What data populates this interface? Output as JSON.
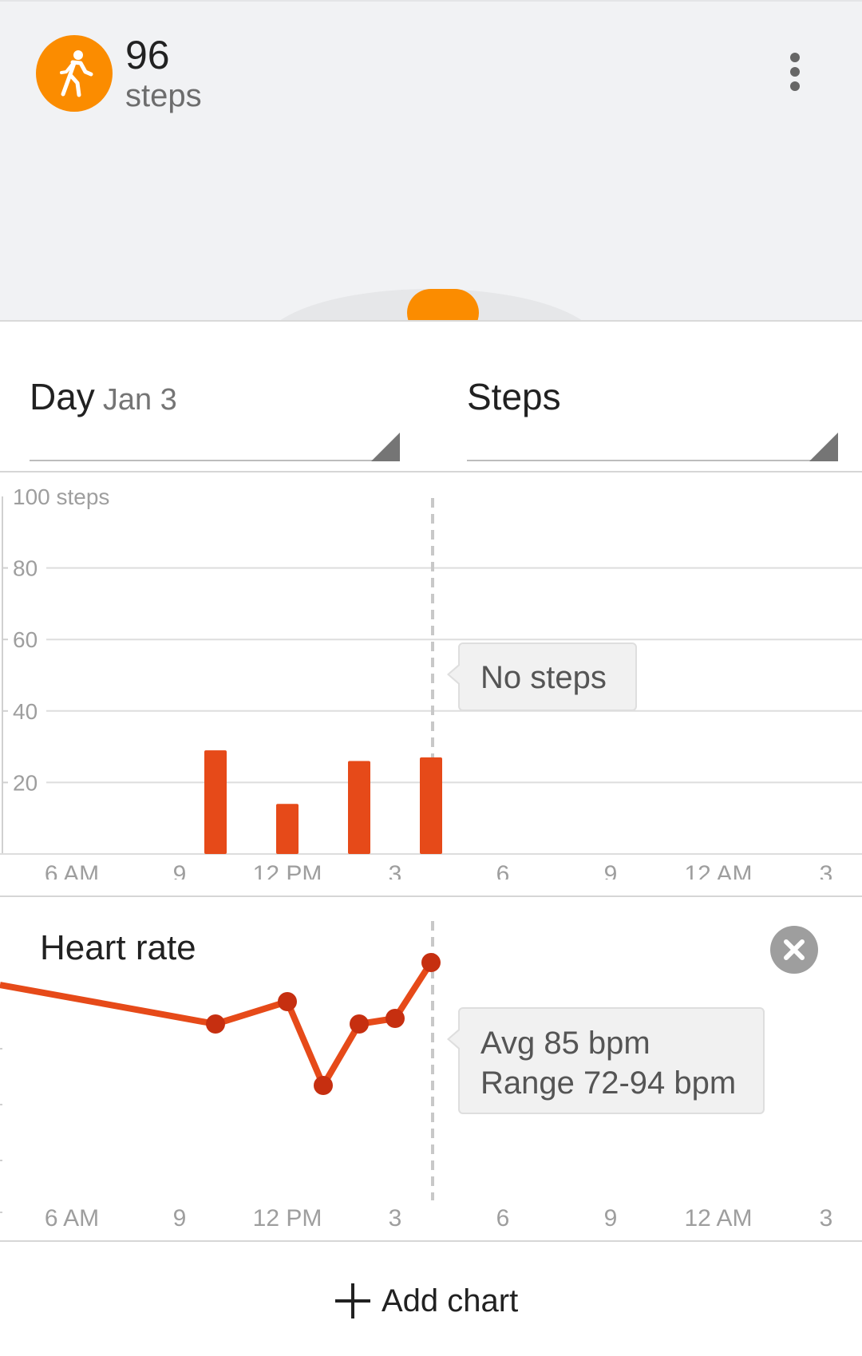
{
  "summary": {
    "steps_value": "96",
    "steps_unit": "steps",
    "accent_color": "#fb8c00",
    "icon": "walking-person-icon"
  },
  "selectors": {
    "period": {
      "label": "Day",
      "date": "Jan 3"
    },
    "metric": {
      "label": "Steps"
    }
  },
  "steps_chart": {
    "tooltip": "No steps",
    "bar_color": "#e64a19"
  },
  "heart_chart": {
    "title": "Heart rate",
    "tooltip_avg": "Avg 85 bpm",
    "tooltip_range": "Range 72-94 bpm",
    "line_color": "#e64a19"
  },
  "chart_data": [
    {
      "type": "bar",
      "title": "",
      "y_unit_label": "100 steps",
      "y_ticks": [
        "80",
        "60",
        "40",
        "20"
      ],
      "ylim": [
        0,
        100
      ],
      "x_ticks": [
        "6 AM",
        "9",
        "12 PM",
        "3",
        "6",
        "9",
        "12 AM",
        "3"
      ],
      "x_tick_hours": [
        6,
        9,
        12,
        15,
        18,
        21,
        24,
        27
      ],
      "current_time_hour": 16,
      "bars": [
        {
          "hour": 10,
          "value": 29
        },
        {
          "hour": 12,
          "value": 14
        },
        {
          "hour": 14,
          "value": 26
        },
        {
          "hour": 16,
          "value": 27
        }
      ],
      "grid": true
    },
    {
      "type": "line",
      "title": "Heart rate",
      "x_ticks": [
        "6 AM",
        "9",
        "12 PM",
        "3",
        "6",
        "9",
        "12 AM",
        "3"
      ],
      "x_tick_hours": [
        6,
        9,
        12,
        15,
        18,
        21,
        24,
        27
      ],
      "series": [
        {
          "points": [
            {
              "hour": 4,
              "value": 90
            },
            {
              "hour": 10,
              "value": 83
            },
            {
              "hour": 12,
              "value": 87
            },
            {
              "hour": 13,
              "value": 72
            },
            {
              "hour": 14,
              "value": 83
            },
            {
              "hour": 15,
              "value": 84
            },
            {
              "hour": 16,
              "value": 94
            }
          ]
        }
      ],
      "ylim": [
        60,
        100
      ]
    }
  ],
  "footer": {
    "add_chart_label": "Add chart"
  }
}
